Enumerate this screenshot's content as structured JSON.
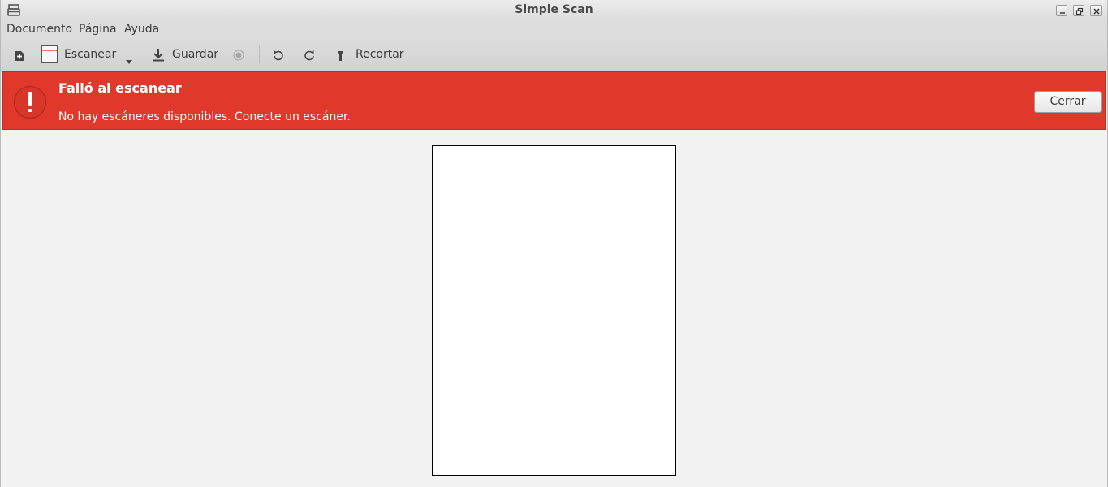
{
  "window": {
    "title": "Simple Scan",
    "app_icon": "scanner-icon",
    "controls": [
      "minimize-icon",
      "maximize-icon",
      "close-icon"
    ]
  },
  "menubar": {
    "items": [
      {
        "label": "Documento"
      },
      {
        "label": "Página"
      },
      {
        "label": "Ayuda"
      }
    ]
  },
  "toolbar": {
    "new_icon": "new-document-icon",
    "scan_label": "Escanear",
    "scan_icon": "scan-page-icon",
    "scan_menu_icon": "dropdown-arrow-icon",
    "save_label": "Guardar",
    "save_icon": "download-icon",
    "stop_icon": "stop-icon",
    "rotate_left_icon": "rotate-left-icon",
    "rotate_right_icon": "rotate-right-icon",
    "crop_label": "Recortar",
    "crop_icon": "crop-icon"
  },
  "infobar": {
    "icon": "error-icon",
    "title": "Falló al escanear",
    "message": "No hay escáneres disponibles. Conecte un escáner.",
    "close_label": "Cerrar",
    "color": "#e0392b"
  }
}
